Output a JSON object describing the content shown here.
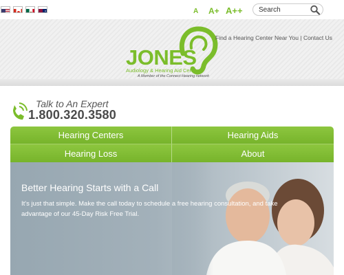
{
  "flags": [
    "us-flag",
    "canada-flag",
    "mexico-flag",
    "australia-flag"
  ],
  "text_size": {
    "small": "A",
    "medium": "A+",
    "large": "A++"
  },
  "search": {
    "placeholder": "Search"
  },
  "header_links": {
    "find_center": "Find a Hearing Center Near You",
    "separator": "|",
    "contact": "Contact Us"
  },
  "logo": {
    "name": "JONES",
    "subtitle": "Audiology & Hearing Aid Centers",
    "member": "A Member of the Connect Hearing network"
  },
  "talk": {
    "label": "Talk to An Expert",
    "phone": "1.800.320.3580"
  },
  "nav": {
    "hearing_centers": "Hearing Centers",
    "hearing_aids": "Hearing Aids",
    "hearing_loss": "Hearing Loss",
    "about": "About"
  },
  "hero": {
    "title": "Better Hearing Starts with a Call",
    "text": "It's just that simple. Make the call today to schedule a free hearing consultation, and take advantage of our 45-Day Risk Free Trial."
  },
  "colors": {
    "brand_green": "#7bbd2b",
    "nav_green": "#8dc63f"
  }
}
